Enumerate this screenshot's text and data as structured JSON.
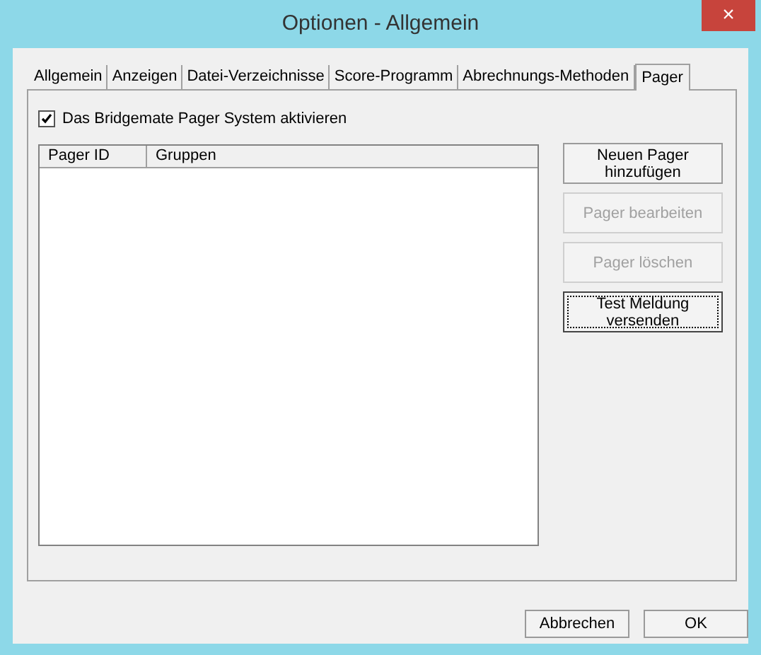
{
  "window": {
    "title": "Optionen - Allgemein",
    "close": "×"
  },
  "tabs": [
    {
      "label": "Allgemein",
      "selected": false
    },
    {
      "label": "Anzeigen",
      "selected": false
    },
    {
      "label": "Datei-Verzeichnisse",
      "selected": false
    },
    {
      "label": "Score-Programm",
      "selected": false
    },
    {
      "label": "Abrechnungs-Methoden",
      "selected": false
    },
    {
      "label": "Pager",
      "selected": true
    }
  ],
  "checkbox": {
    "label": "Das Bridgemate Pager System aktivieren",
    "checked": true
  },
  "table": {
    "columns": [
      "Pager ID",
      "Gruppen"
    ]
  },
  "side_buttons": [
    {
      "label": "Neuen Pager hinzufügen",
      "disabled": false,
      "focused": false
    },
    {
      "label": "Pager bearbeiten",
      "disabled": true,
      "focused": false
    },
    {
      "label": "Pager löschen",
      "disabled": true,
      "focused": false
    },
    {
      "label": "Test Meldung versenden",
      "disabled": false,
      "focused": true
    }
  ],
  "buttons": [
    "Abbrechen",
    "OK"
  ]
}
